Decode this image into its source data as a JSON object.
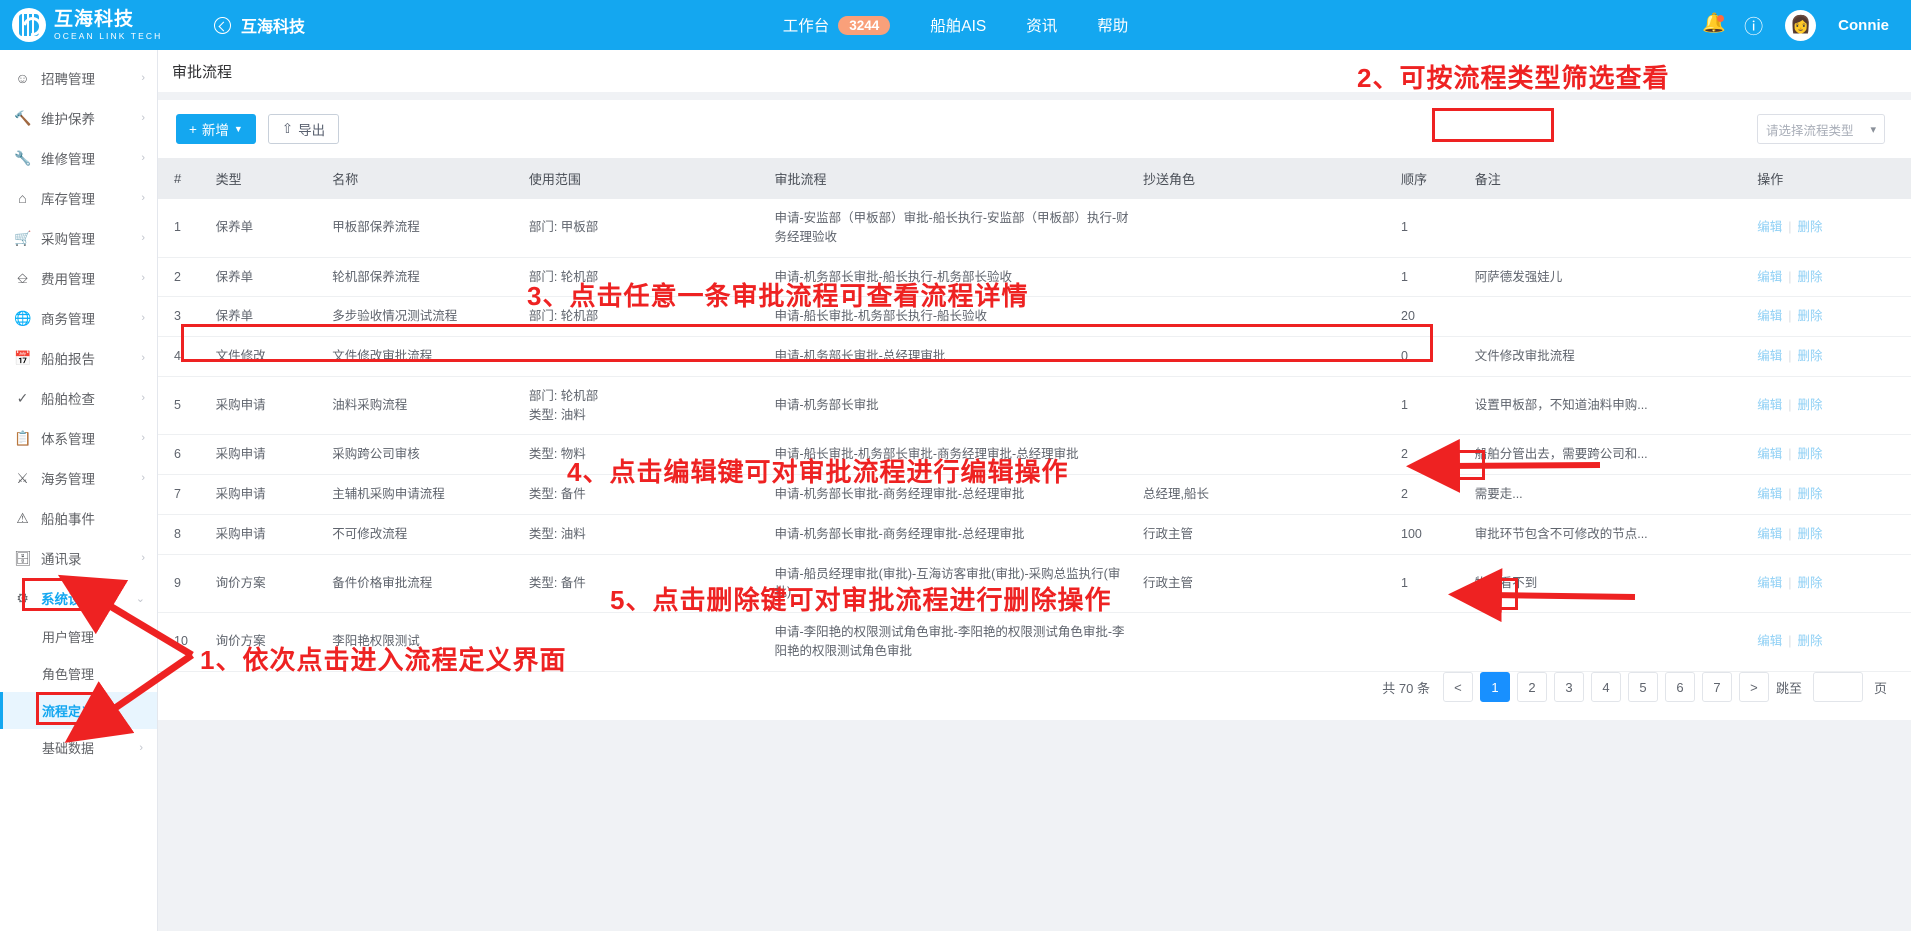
{
  "topbar": {
    "brand_cn": "互海科技",
    "brand_en": "OCEAN LINK TECH",
    "back_title": "互海科技",
    "nav": [
      {
        "label": "工作台",
        "badge": "3244"
      },
      {
        "label": "船舶AIS",
        "badge": ""
      },
      {
        "label": "资讯",
        "badge": ""
      },
      {
        "label": "帮助",
        "badge": ""
      }
    ],
    "bell_icon": "bell-icon",
    "help_icon": "question-circle-icon",
    "avatar_icon": "user-avatar",
    "username": "Connie"
  },
  "sidebar": {
    "items": [
      {
        "label": "招聘管理",
        "icon": "user-plus-icon",
        "arrow": "›"
      },
      {
        "label": "维护保养",
        "icon": "wrench-hammer-icon",
        "arrow": "›"
      },
      {
        "label": "维修管理",
        "icon": "spanner-icon",
        "arrow": "›"
      },
      {
        "label": "库存管理",
        "icon": "home-icon",
        "arrow": "›"
      },
      {
        "label": "采购管理",
        "icon": "cart-icon",
        "arrow": "›"
      },
      {
        "label": "费用管理",
        "icon": "database-icon",
        "arrow": "›"
      },
      {
        "label": "商务管理",
        "icon": "globe-icon",
        "arrow": "›"
      },
      {
        "label": "船舶报告",
        "icon": "calendar-icon",
        "arrow": "›"
      },
      {
        "label": "船舶检查",
        "icon": "check-circle-icon",
        "arrow": "›"
      },
      {
        "label": "体系管理",
        "icon": "copy-icon",
        "arrow": "›"
      },
      {
        "label": "海务管理",
        "icon": "signpost-icon",
        "arrow": "›"
      },
      {
        "label": "船舶事件",
        "icon": "warning-triangle-icon",
        "arrow": ""
      },
      {
        "label": "通讯录",
        "icon": "contacts-icon",
        "arrow": "›"
      },
      {
        "label": "系统设置",
        "icon": "gear-icon",
        "arrow": "⌄",
        "active": true
      }
    ],
    "subitems": [
      {
        "label": "用户管理",
        "arrow": ""
      },
      {
        "label": "角色管理",
        "arrow": ""
      },
      {
        "label": "流程定义",
        "arrow": "",
        "active": true
      },
      {
        "label": "基础数据",
        "arrow": "›"
      }
    ]
  },
  "page": {
    "title": "审批流程",
    "add_label": "新增",
    "add_icon": "plus-icon",
    "export_label": "导出",
    "export_icon": "upload-icon",
    "filter_placeholder": "请选择流程类型",
    "filter_chevron": "chevron-down-icon"
  },
  "table": {
    "headers": [
      "#",
      "类型",
      "名称",
      "使用范围",
      "审批流程",
      "抄送角色",
      "顺序",
      "备注",
      "操作"
    ],
    "edit_label": "编辑",
    "delete_label": "删除",
    "rows": [
      {
        "idx": "1",
        "type": "保养单",
        "name": "甲板部保养流程",
        "scope": "部门: 甲板部",
        "flow": "申请-安监部（甲板部）审批-船长执行-安监部（甲板部）执行-财务经理验收",
        "cc": "",
        "order": "1",
        "note": ""
      },
      {
        "idx": "2",
        "type": "保养单",
        "name": "轮机部保养流程",
        "scope": "部门: 轮机部",
        "flow": "申请-机务部长审批-船长执行-机务部长验收",
        "cc": "",
        "order": "1",
        "note": "阿萨德发强娃儿"
      },
      {
        "idx": "3",
        "type": "保养单",
        "name": "多步验收情况测试流程",
        "scope": "部门: 轮机部",
        "flow": "申请-船长审批-机务部长执行-船长验收",
        "cc": "",
        "order": "20",
        "note": ""
      },
      {
        "idx": "4",
        "type": "文件修改",
        "name": "文件修改审批流程",
        "scope": "",
        "flow": "申请-机务部长审批-总经理审批",
        "cc": "",
        "order": "0",
        "note": "文件修改审批流程",
        "highlight": true
      },
      {
        "idx": "5",
        "type": "采购申请",
        "name": "油料采购流程",
        "scope": "部门: 轮机部\n类型: 油料",
        "flow": "申请-机务部长审批",
        "cc": "",
        "order": "1",
        "note": "设置甲板部，不知道油料申购..."
      },
      {
        "idx": "6",
        "type": "采购申请",
        "name": "采购跨公司审核",
        "scope": "类型: 物料",
        "flow": "申请-船长审批-机务部长审批-商务经理审批-总经理审批",
        "cc": "",
        "order": "2",
        "note": "船舶分管出去，需要跨公司和..."
      },
      {
        "idx": "7",
        "type": "采购申请",
        "name": "主辅机采购申请流程",
        "scope": "类型: 备件",
        "flow": "申请-机务部长审批-商务经理审批-总经理审批",
        "cc": "总经理,船长",
        "order": "2",
        "note": "需要走..."
      },
      {
        "idx": "8",
        "type": "采购申请",
        "name": "不可修改流程",
        "scope": "类型: 油料",
        "flow": "申请-机务部长审批-商务经理审批-总经理审批",
        "cc": "行政主管",
        "order": "100",
        "note": "审批环节包含不可修改的节点..."
      },
      {
        "idx": "9",
        "type": "询价方案",
        "name": "备件价格审批流程",
        "scope": "类型: 备件",
        "flow": "申请-船员经理审批(审批)-互海访客审批(审批)-采购总监执行(审批)",
        "cc": "行政主管",
        "order": "1",
        "note": "物料看不到"
      },
      {
        "idx": "10",
        "type": "询价方案",
        "name": "李阳艳权限测试",
        "scope": "",
        "flow": "申请-李阳艳的权限测试角色审批-李阳艳的权限测试角色审批-李阳艳的权限测试角色审批",
        "cc": "",
        "order": "",
        "note": ""
      }
    ]
  },
  "pagination": {
    "total_text": "共 70 条",
    "prev": "<",
    "next": ">",
    "pages": [
      "1",
      "2",
      "3",
      "4",
      "5",
      "6",
      "7"
    ],
    "current": "1",
    "jump_label": "跳至",
    "jump_value": "",
    "jump_suffix": "页"
  },
  "annotations": {
    "a1": "1、依次点击进入流程定义界面",
    "a2": "2、可按流程类型筛选查看",
    "a3": "3、点击任意一条审批流程可查看流程详情",
    "a4": "4、点击编辑键可对审批流程进行编辑操作",
    "a5": "5、点击删除键可对审批流程进行删除操作"
  }
}
